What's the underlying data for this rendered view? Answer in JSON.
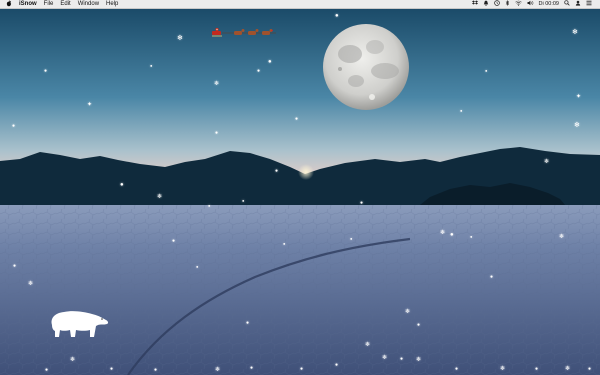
{
  "menubar": {
    "apple_icon": "apple-icon",
    "app_name": "iSnow",
    "menus": [
      "File",
      "Edit",
      "Window",
      "Help"
    ],
    "status_icons": [
      "dropbox-icon",
      "bell-icon",
      "history-icon",
      "bluetooth-icon",
      "wifi-icon",
      "volume-icon"
    ],
    "clock": "Di 00:09",
    "right_icons": [
      "search-icon",
      "user-icon",
      "list-icon"
    ]
  },
  "desktop": {
    "wallpaper": "moonlit desert lake bed with mountains",
    "colors": {
      "sky_top": "#1d4f6e",
      "sky_mid": "#4f8aa8",
      "horizon_glow": "#f0c9c1",
      "mountains": "#0d2536",
      "ground": "#6d80a4",
      "moon": "#d8d8d6"
    },
    "overlay": [
      "santa-sleigh-icon",
      "moon",
      "polar-bear-icon",
      "snowflakes"
    ]
  }
}
